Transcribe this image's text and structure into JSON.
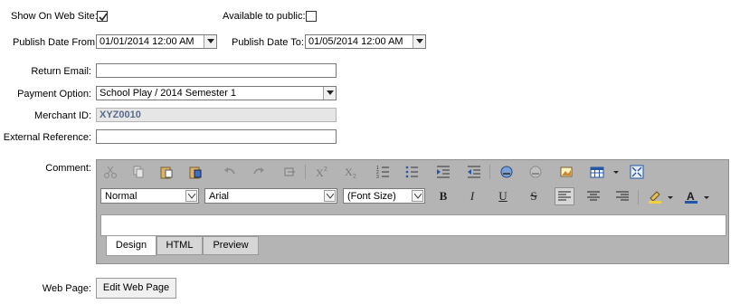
{
  "show_on_web": {
    "label": "Show On Web Site:",
    "checked": true
  },
  "available_public": {
    "label": "Available to public:",
    "checked": false
  },
  "publish_from": {
    "label": "Publish Date From:",
    "value": "01/01/2014 12:00 AM"
  },
  "publish_to": {
    "label": "Publish Date To:",
    "value": "01/05/2014 12:00 AM"
  },
  "return_email": {
    "label": "Return Email:",
    "value": ""
  },
  "payment_option": {
    "label": "Payment Option:",
    "value": "School Play / 2014 Semester 1"
  },
  "merchant_id": {
    "label": "Merchant ID:",
    "value": "XYZ0010"
  },
  "external_ref": {
    "label": "External Reference:",
    "value": ""
  },
  "comment": {
    "label": "Comment:",
    "format_value": "Normal",
    "font_value": "Arial",
    "size_value": "(Font Size)",
    "bold": "B",
    "italic": "I",
    "underline": "U",
    "strike": "S",
    "tabs": [
      "Design",
      "HTML",
      "Preview"
    ],
    "active_tab": "Design",
    "toolbar_icons": [
      "cut-icon",
      "copy-icon",
      "paste-icon",
      "paste-word-icon",
      "undo-icon",
      "redo-icon",
      "format-stripper-icon",
      "superscript-icon",
      "subscript-icon",
      "numbered-list-icon",
      "bullet-list-icon",
      "indent-icon",
      "outdent-icon",
      "hyperlink-icon",
      "remove-link-icon",
      "image-icon",
      "table-icon",
      "fullscreen-icon"
    ]
  },
  "web_page": {
    "label": "Web Page:",
    "button": "Edit Web Page"
  }
}
